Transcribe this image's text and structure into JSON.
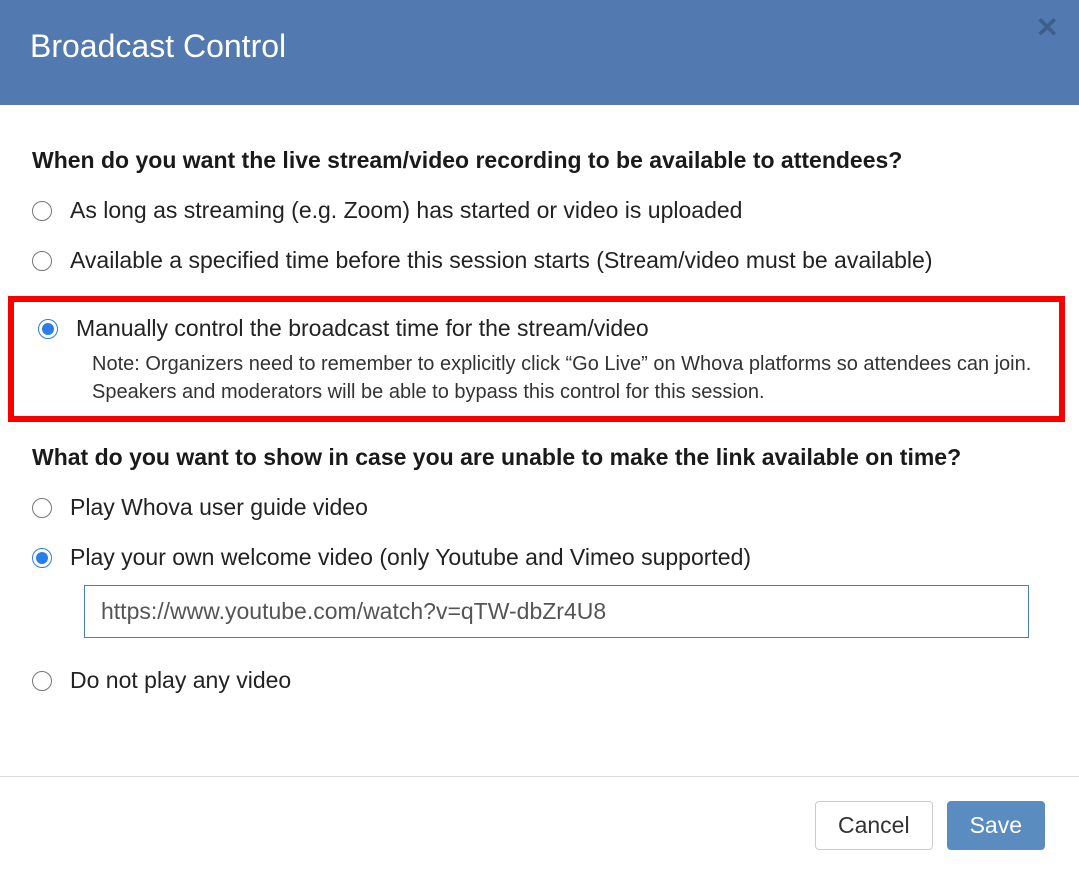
{
  "header": {
    "title": "Broadcast Control",
    "close_glyph": "✕"
  },
  "section1": {
    "heading": "When do you want the live stream/video recording to be available to attendees?",
    "options": [
      {
        "label": "As long as streaming (e.g. Zoom) has started or video is uploaded"
      },
      {
        "label": "Available a specified time before this session starts (Stream/video must be available)"
      },
      {
        "label": "Manually control the broadcast time for the stream/video",
        "note_prefix": "Note: ",
        "note": "Organizers need to remember to explicitly click “Go Live” on Whova platforms so attendees can join. Speakers and moderators will be able to bypass this control for this session."
      }
    ],
    "selected_index": 2
  },
  "section2": {
    "heading": "What do you want to show in case you are unable to make the link available on time?",
    "options": [
      {
        "label": "Play Whova user guide video"
      },
      {
        "label": "Play your own welcome video (only Youtube and Vimeo supported)"
      },
      {
        "label": "Do not play any video"
      }
    ],
    "selected_index": 1,
    "url_value": "https://www.youtube.com/watch?v=qTW-dbZr4U8"
  },
  "footer": {
    "cancel_label": "Cancel",
    "save_label": "Save"
  }
}
